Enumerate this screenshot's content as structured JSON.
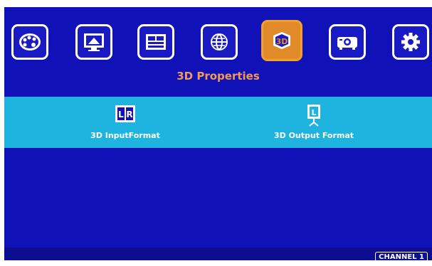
{
  "menu": {
    "tabs": [
      {
        "icon": "palette-icon",
        "active": false
      },
      {
        "icon": "display-settings-icon",
        "active": false
      },
      {
        "icon": "layout-icon",
        "active": false
      },
      {
        "icon": "globe-icon",
        "active": false
      },
      {
        "icon": "3d-icon",
        "active": true,
        "icon_text": "3D"
      },
      {
        "icon": "projector-icon",
        "active": false
      },
      {
        "icon": "gear-icon",
        "active": false
      }
    ],
    "title": "3D Properties"
  },
  "submenu": {
    "items": [
      {
        "label": "3D InputFormat",
        "icon": "lr-icon",
        "icon_text": [
          "L",
          "R"
        ]
      },
      {
        "label": "3D Output Format",
        "icon": "screen-l-icon",
        "icon_text": "L"
      }
    ]
  },
  "status": {
    "channel": "CHANNEL 1"
  },
  "colors": {
    "background": "#1111b8",
    "band": "#1fb4e0",
    "active_tab": "#e08a2a",
    "title": "#f29a52"
  }
}
